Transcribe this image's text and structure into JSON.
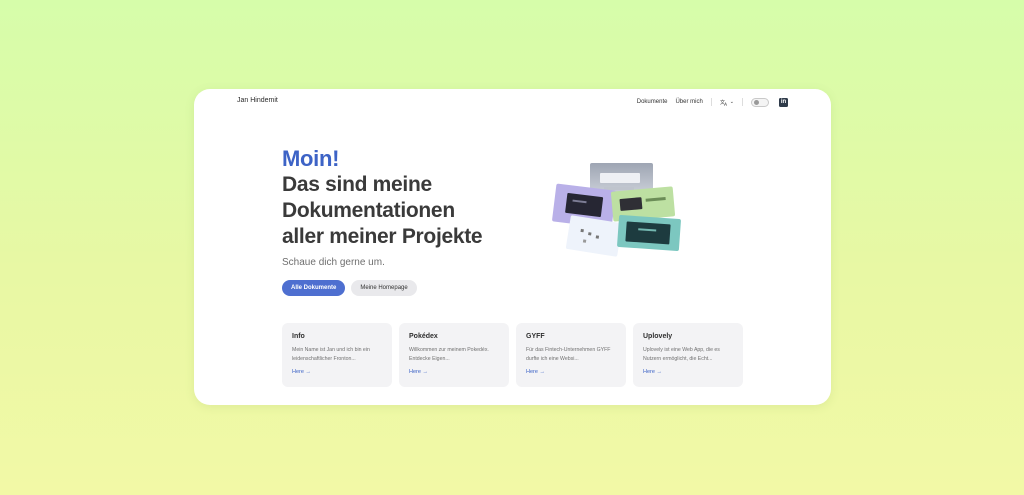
{
  "header": {
    "brand": "Jan Hindemit",
    "nav_documents": "Dokumente",
    "nav_about": "Über mich",
    "lang_icon": "translate-icon",
    "lang_chevron": "⌄",
    "linkedin_label": "in"
  },
  "hero": {
    "greeting": "Moin!",
    "title_lines": [
      "Das sind meine",
      "Dokumentationen",
      "aller meiner Projekte"
    ],
    "subtitle": "Schaue dich gerne um.",
    "primary_button": "Alle Dokumente",
    "secondary_button": "Meine Homepage"
  },
  "cards": [
    {
      "title": "Info",
      "desc": "Mein Name ist Jan und ich bin ein leidenschaftlicher Fronton...",
      "link": "Here →"
    },
    {
      "title": "Pokédex",
      "desc": "Willkommen zur meinem Pokedéx. Entdecke Eigen...",
      "link": "Here →"
    },
    {
      "title": "GYFF",
      "desc": "Für das Fintech-Unternehmen GYFF durfte ich eine Websi...",
      "link": "Here →"
    },
    {
      "title": "Uplovely",
      "desc": "Uplovely ist eine Web App, die es Nutzern ermöglicht, die Echt...",
      "link": "Here →"
    }
  ],
  "colors": {
    "accent": "#3d63c6",
    "primary_button": "#4e6fd0",
    "background_top": "#d6fdaa",
    "background_bottom": "#f2f9a6"
  }
}
